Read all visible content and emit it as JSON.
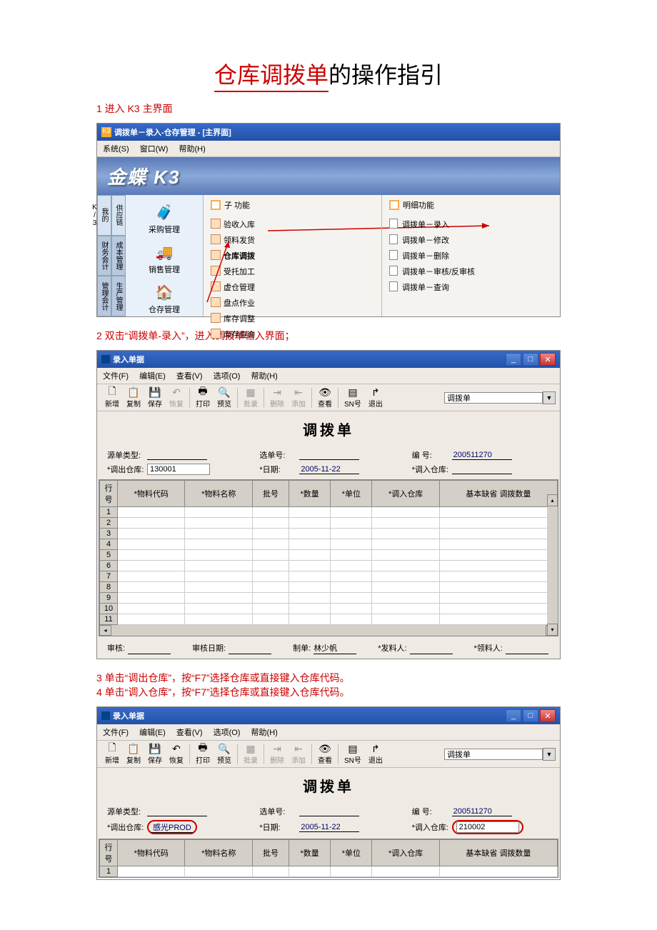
{
  "doc_title_a": "仓库调拨单",
  "doc_title_b": "的操作指引",
  "step1": "1 进入 K3 主界面",
  "step2": "2   双击“调拨单-录入”，进入调拨单输入界面；",
  "step3": "3 单击“调出仓库”，按“F7”选择仓库或直接键入仓库代码。",
  "step4": "4 单击“调入仓库”，按“F7”选择仓库或直接键入仓库代码。",
  "k3": {
    "title": "调拨单－录入-仓存管理  -  [主界面]",
    "menu": {
      "sys": "系统(S)",
      "win": "窗口(W)",
      "help": "帮助(H)"
    },
    "logo": "金蝶 K3",
    "vtabs": [
      "供应链",
      "成本管理",
      "生产管理"
    ],
    "vside": [
      "我的K/3",
      "财务会计",
      "管理会计"
    ],
    "modules": [
      {
        "icon": "🧳",
        "lb": "采购管理"
      },
      {
        "icon": "🚚",
        "lb": "销售管理"
      },
      {
        "icon": "🏠",
        "lb": "仓存管理"
      }
    ],
    "sub_h": "子 功能",
    "sub": [
      "验收入库",
      "领料发货",
      "仓库调拨",
      "受托加工",
      "虚仓管理",
      "盘点作业",
      "库存调整",
      "库存查询"
    ],
    "det_h": "明细功能",
    "det": [
      "调拨单－录入",
      "调拨单－修改",
      "调拨单－删除",
      "调拨单－审核/反审核",
      "调拨单－查询"
    ]
  },
  "form": {
    "wtitle": "录入单据",
    "menu": {
      "file": "文件(F)",
      "edit": "编辑(E)",
      "view": "查看(V)",
      "opt": "选项(O)",
      "help": "帮助(H)"
    },
    "tbtn": {
      "new": "新增",
      "copy": "复制",
      "save": "保存",
      "undo": "恢复",
      "print": "打印",
      "preview": "预览",
      "batch": "批录",
      "del": "删除",
      "add": "添加",
      "look": "查看",
      "sn": "SN号",
      "exit": "退出"
    },
    "doc_type": "调拨单",
    "ftitle": "调拨单",
    "lbl": {
      "src": "源单类型:",
      "sel": "选单号:",
      "no": "编    号:",
      "out": "*调出仓库:",
      "date": "*日期:",
      "in": "*调入仓库:"
    },
    "val1": {
      "no": "200511270",
      "out": "130001",
      "date": "2005-11-22",
      "in": ""
    },
    "val2": {
      "no": "200511270",
      "out": "感光PROD",
      "date": "2005-11-22",
      "in": "210002"
    },
    "cols": [
      "行号",
      "*物料代码",
      "*物料名称",
      "批号",
      "*数量",
      "*单位",
      "*调入仓库",
      "基本缺省\n调拨数量"
    ],
    "foot": {
      "aud": "审核:",
      "adate": "审核日期:",
      "mk": "制单:",
      "mkv": "林少帆",
      "iss": "*发料人:",
      "rec": "*领料人:"
    }
  }
}
